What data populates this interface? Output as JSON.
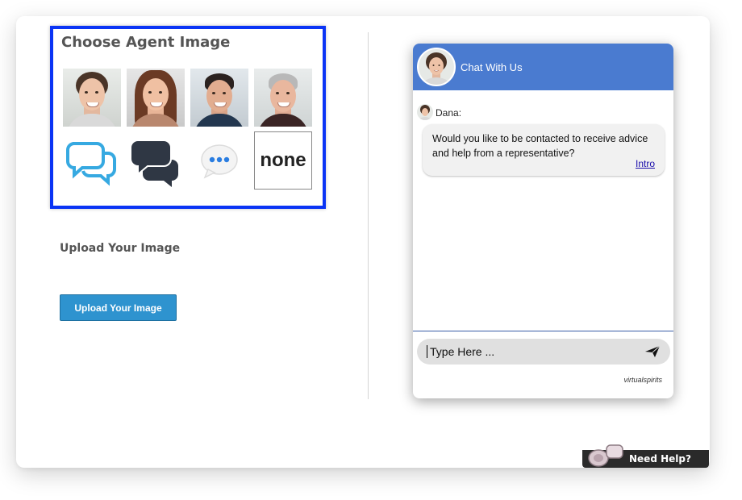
{
  "agent_picker": {
    "title": "Choose Agent Image",
    "photos": [
      {
        "name": "agent-photo-woman-short-hair"
      },
      {
        "name": "agent-photo-woman-long-hair"
      },
      {
        "name": "agent-photo-man-dark-hair"
      },
      {
        "name": "agent-photo-man-gray-hair"
      }
    ],
    "icons": [
      {
        "name": "chat-bubbles-blue-icon"
      },
      {
        "name": "chat-bubbles-dark-icon"
      },
      {
        "name": "typing-bubble-icon"
      }
    ],
    "none_label": "none"
  },
  "upload": {
    "label": "Upload Your Image",
    "button_label": "Upload Your Image"
  },
  "chat": {
    "header_title": "Chat With Us",
    "sender": "Dana:",
    "message": "Would you like to be contacted to receive advice and help from a representative?",
    "link_label": "Intro",
    "input_placeholder": "Type Here ...",
    "brand": "virtualspirits"
  },
  "help_tab": {
    "label": "Need Help?"
  },
  "colors": {
    "highlight_border": "#0a34f5",
    "chat_header": "#4a7bd0",
    "upload_button": "#2e93cf",
    "link": "#1a0dab"
  }
}
